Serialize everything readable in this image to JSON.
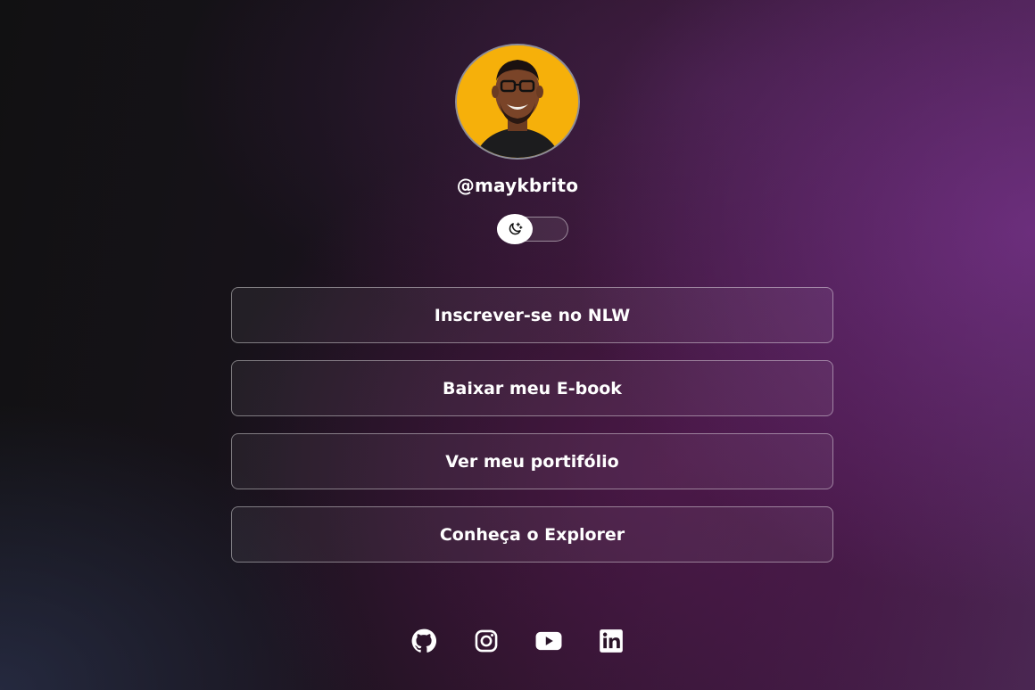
{
  "profile": {
    "username": "@maykbrito",
    "avatar_icon": "person-avatar",
    "avatar_bg": "#f6b00a"
  },
  "theme_switch": {
    "icon": "moon-stars-icon",
    "state": "dark"
  },
  "links": [
    {
      "label": "Inscrever-se no NLW"
    },
    {
      "label": "Baixar meu E-book"
    },
    {
      "label": "Ver meu portifólio"
    },
    {
      "label": "Conheça o Explorer"
    }
  ],
  "social": [
    {
      "icon": "github-icon"
    },
    {
      "icon": "instagram-icon"
    },
    {
      "icon": "youtube-icon"
    },
    {
      "icon": "linkedin-icon"
    }
  ],
  "colors": {
    "text": "#ffffff",
    "accent_purple": "#5b2a6e",
    "border": "#8d8d99"
  }
}
